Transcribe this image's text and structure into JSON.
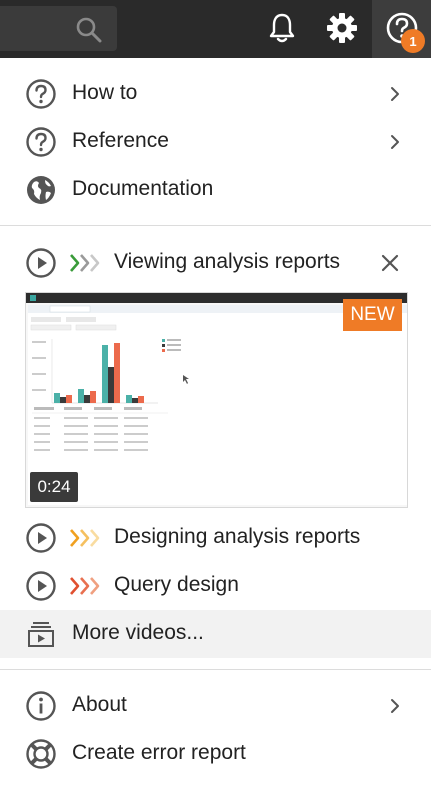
{
  "menu": {
    "top_items": [
      {
        "label": "How to",
        "icon": "question-circle-icon",
        "has_submenu": true
      },
      {
        "label": "Reference",
        "icon": "question-circle-icon",
        "has_submenu": true
      },
      {
        "label": "Documentation",
        "icon": "globe-icon",
        "has_submenu": false
      }
    ],
    "videos": [
      {
        "label": "Viewing analysis reports",
        "arrow_colors": [
          "#3a9b3a",
          "#9a9a9a",
          "#c8c8c8"
        ]
      },
      {
        "label": "Designing analysis reports",
        "arrow_colors": [
          "#f0a020",
          "#f5c060",
          "#f9dca0"
        ]
      },
      {
        "label": "Query design",
        "arrow_colors": [
          "#e05030",
          "#e87050",
          "#f0a080"
        ]
      }
    ],
    "preview": {
      "new_badge": "NEW",
      "duration": "0:24"
    },
    "more_videos": "More videos...",
    "bottom_items": [
      {
        "label": "About",
        "icon": "info-circle-icon",
        "has_submenu": true
      },
      {
        "label": "Create error report",
        "icon": "lifebuoy-icon",
        "has_submenu": false
      }
    ]
  },
  "topbar": {
    "notification_count": "1"
  },
  "colors": {
    "topbar": "#2a2a2a",
    "accent_orange": "#ef7b26",
    "icon_gray": "#555555"
  }
}
